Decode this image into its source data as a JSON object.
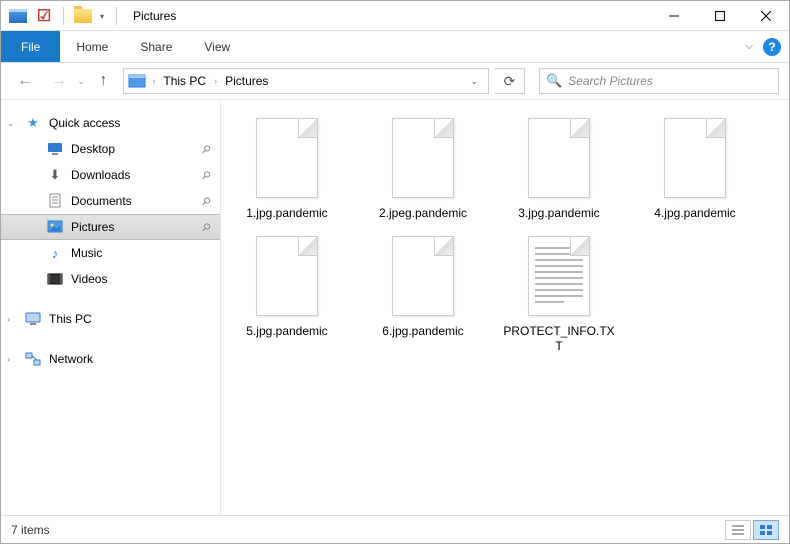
{
  "window": {
    "title": "Pictures"
  },
  "ribbon": {
    "file": "File",
    "home": "Home",
    "share": "Share",
    "view": "View"
  },
  "breadcrumb": {
    "root": "This PC",
    "folder": "Pictures"
  },
  "search": {
    "placeholder": "Search Pictures"
  },
  "sidebar": {
    "quick_access": "Quick access",
    "items": [
      {
        "label": "Desktop",
        "icon": "desktop-icon"
      },
      {
        "label": "Downloads",
        "icon": "download-icon"
      },
      {
        "label": "Documents",
        "icon": "document-icon"
      },
      {
        "label": "Pictures",
        "icon": "pictures-icon",
        "selected": true
      },
      {
        "label": "Music",
        "icon": "music-icon"
      },
      {
        "label": "Videos",
        "icon": "videos-icon"
      }
    ],
    "this_pc": "This PC",
    "network": "Network"
  },
  "files": [
    {
      "name": "1.jpg.pandemic",
      "type": "blank"
    },
    {
      "name": "2.jpeg.pandemic",
      "type": "blank"
    },
    {
      "name": "3.jpg.pandemic",
      "type": "blank"
    },
    {
      "name": "4.jpg.pandemic",
      "type": "blank"
    },
    {
      "name": "5.jpg.pandemic",
      "type": "blank"
    },
    {
      "name": "6.jpg.pandemic",
      "type": "blank"
    },
    {
      "name": "PROTECT_INFO.TXT",
      "type": "txt"
    }
  ],
  "status": {
    "item_count": "7 items"
  }
}
